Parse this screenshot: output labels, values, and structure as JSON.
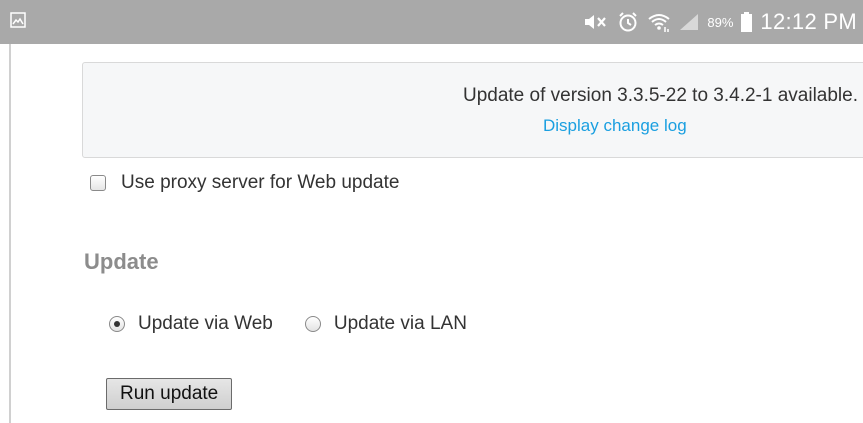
{
  "status_bar": {
    "left_icon": "gallery-icon",
    "icons": [
      "mute-icon",
      "alarm-icon",
      "wifi-icon",
      "signal-icon",
      "battery-icon"
    ],
    "battery_percent": "89%",
    "time": "12:12 PM",
    "background": "#a9a9a9"
  },
  "update_notice": {
    "message": "Update of version 3.3.5-22 to 3.4.2-1 available.",
    "changelog_link": "Display change log",
    "link_color": "#1a9fe0"
  },
  "proxy": {
    "label": "Use proxy server for Web update",
    "checked": false
  },
  "update_section": {
    "heading": "Update",
    "options": [
      {
        "label": "Update via Web",
        "selected": true
      },
      {
        "label": "Update via LAN",
        "selected": false
      }
    ],
    "run_button": "Run update"
  }
}
